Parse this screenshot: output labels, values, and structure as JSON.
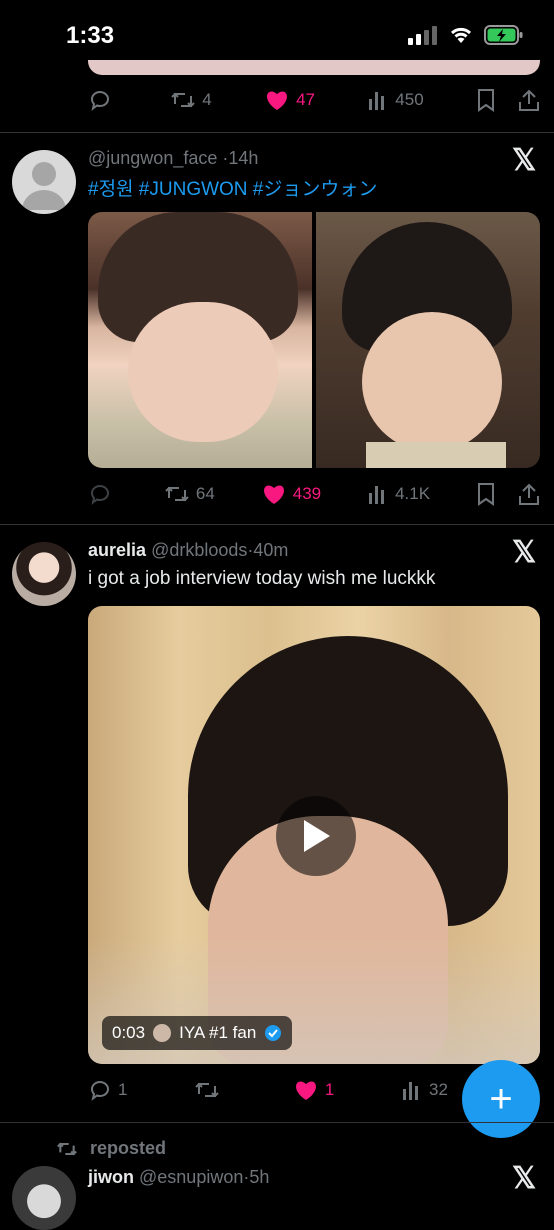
{
  "status_bar": {
    "time": "1:33"
  },
  "post_prev": {
    "replies": "",
    "reposts": "4",
    "likes": "47",
    "views": "450"
  },
  "post1": {
    "handle": "@jungwon_face",
    "time": "14h",
    "hashtags": "#정원 #JUNGWON #ジョンウォン",
    "replies": "",
    "reposts": "64",
    "likes": "439",
    "views": "4.1K"
  },
  "post2": {
    "name": "aurelia",
    "handle": "@drkbloods",
    "time": "40m",
    "text": "i got a job interview today wish me luckkk",
    "video_time": "0:03",
    "video_source": "IYA #1 fan",
    "replies": "1",
    "reposts": "",
    "likes": "1",
    "views": "32"
  },
  "post3": {
    "repost_label": "reposted",
    "name": "jiwon",
    "handle": "@esnupiwon",
    "time": "5h"
  },
  "colors": {
    "accent": "#1d9bf0",
    "like": "#f91880",
    "muted": "#71767b",
    "bg": "#000000"
  },
  "icons": [
    "reply-icon",
    "repost-icon",
    "heart-icon",
    "views-icon",
    "bookmark-icon",
    "share-icon",
    "x-logo-icon",
    "compose-icon",
    "play-icon",
    "verified-icon"
  ]
}
